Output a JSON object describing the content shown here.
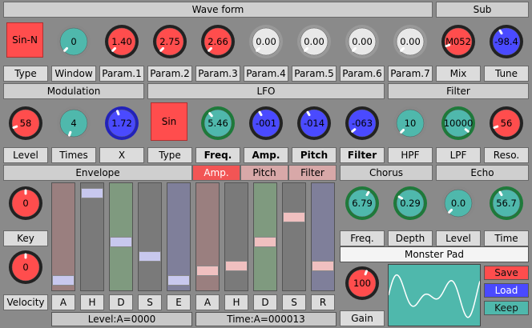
{
  "sections": {
    "waveform": "Wave form",
    "sub": "Sub",
    "modulation": "Modulation",
    "lfo": "LFO",
    "filter": "Filter",
    "envelope": "Envelope",
    "chorus": "Chorus",
    "echo": "Echo"
  },
  "waveform": {
    "type_button": "Sin-N",
    "knobs": [
      "0",
      "1.40",
      "2.75",
      "2.66",
      "0.00",
      "0.00",
      "0.00",
      "0.00"
    ],
    "labels": [
      "Type",
      "Window",
      "Param.1",
      "Param.2",
      "Param.3",
      "Param.4",
      "Param.5",
      "Param.6",
      "Param.7"
    ]
  },
  "sub": {
    "knobs": [
      "M052",
      "-98.4"
    ],
    "labels": [
      "Mix",
      "Tune"
    ]
  },
  "modulation": {
    "knobs": [
      "58",
      "4",
      "1.72"
    ],
    "labels": [
      "Level",
      "Times",
      "X"
    ]
  },
  "lfo": {
    "type_button": "Sin",
    "knobs": [
      "5.46",
      "-001",
      "-014",
      "-063"
    ],
    "labels": [
      "Type",
      "Freq.",
      "Amp.",
      "Pitch",
      "Filter"
    ]
  },
  "filter": {
    "knobs": [
      "10",
      "10000",
      "56"
    ],
    "labels": [
      "HPF",
      "LPF",
      "Reso."
    ]
  },
  "envelope": {
    "tabs": [
      "Amp.",
      "Pitch",
      "Filter"
    ],
    "key_knob": "0",
    "key_label": "Key",
    "velocity_knob": "0",
    "velocity_label": "Velocity",
    "slider_labels_left": [
      "A",
      "H",
      "D",
      "S",
      "E"
    ],
    "slider_labels_right": [
      "A",
      "H",
      "D",
      "S",
      "R"
    ],
    "slider_levels_left": [
      0.05,
      0.95,
      0.45,
      0.3,
      0.05
    ],
    "slider_levels_right": [
      0.15,
      0.2,
      0.45,
      0.7,
      0.2
    ],
    "level_readout": "Level:A=0000",
    "time_readout": "Time:A=000013"
  },
  "chorus": {
    "knobs": [
      "6.79",
      "0.29"
    ],
    "labels": [
      "Freq.",
      "Depth"
    ]
  },
  "echo": {
    "knobs": [
      "0.0",
      "56.7"
    ],
    "labels": [
      "Level",
      "Time"
    ]
  },
  "preset": {
    "name": "Monster Pad",
    "gain_knob": "100",
    "gain_label": "Gain"
  },
  "actions": {
    "save": "Save",
    "load": "Load",
    "keep": "Keep"
  },
  "colors": {
    "red": "#ff4d4d",
    "teal": "#4fb8ac",
    "blue": "#4a4aff",
    "white": "#e8e8e8",
    "ring_green": "#1e7a3a",
    "ring_blue": "#2222bb"
  }
}
